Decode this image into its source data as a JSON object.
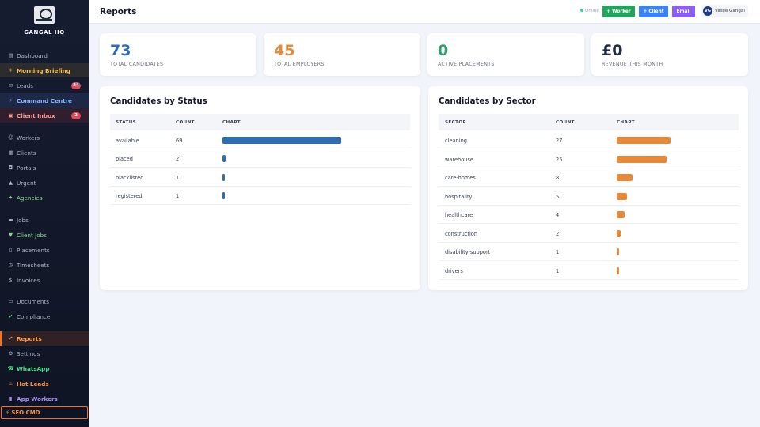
{
  "app": {
    "brand": "GANGAL HQ"
  },
  "header": {
    "title": "Reports",
    "status": "Online",
    "buttons": {
      "worker": "+ Worker",
      "client": "+ Client",
      "email": "Email"
    },
    "user": {
      "initials": "VG",
      "name": "Vasile Gangal"
    }
  },
  "sidebar": {
    "items": [
      {
        "label": "Dashboard",
        "icon": "chart-icon"
      },
      {
        "label": "Morning Briefing",
        "icon": "sunrise-icon"
      },
      {
        "label": "Leads",
        "icon": "envelope-icon",
        "badge": "24"
      },
      {
        "label": "Command Centre",
        "icon": "lightning-icon"
      },
      {
        "label": "Client Inbox",
        "icon": "inbox-icon",
        "badge": "2"
      },
      {
        "label": "Workers",
        "icon": "people-icon"
      },
      {
        "label": "Clients",
        "icon": "building-icon"
      },
      {
        "label": "Portals",
        "icon": "lock-icon"
      },
      {
        "label": "Urgent",
        "icon": "siren-icon"
      },
      {
        "label": "Agencies",
        "icon": "handshake-icon"
      },
      {
        "label": "Jobs",
        "icon": "briefcase-icon"
      },
      {
        "label": "Client Jobs",
        "icon": "inbox-tray-icon"
      },
      {
        "label": "Placements",
        "icon": "clipboard-icon"
      },
      {
        "label": "Timesheets",
        "icon": "clock-icon"
      },
      {
        "label": "Invoices",
        "icon": "money-icon"
      },
      {
        "label": "Documents",
        "icon": "document-icon"
      },
      {
        "label": "Compliance",
        "icon": "check-icon"
      },
      {
        "label": "Reports",
        "icon": "chart-up-icon"
      },
      {
        "label": "Settings",
        "icon": "gear-icon"
      },
      {
        "label": "WhatsApp",
        "icon": "phone-icon"
      },
      {
        "label": "Hot Leads",
        "icon": "fire-icon"
      },
      {
        "label": "App Workers",
        "icon": "mobile-icon"
      }
    ],
    "seo": "⚡ SEO CMD"
  },
  "stats": [
    {
      "value": "73",
      "label": "TOTAL CANDIDATES",
      "color": "#2f6db3"
    },
    {
      "value": "45",
      "label": "TOTAL EMPLOYERS",
      "color": "#e8893a"
    },
    {
      "value": "0",
      "label": "ACTIVE PLACEMENTS",
      "color": "#2f9e6b"
    },
    {
      "value": "£0",
      "label": "REVENUE THIS MONTH",
      "color": "#1e2a44"
    }
  ],
  "status_panel": {
    "title": "Candidates by Status",
    "columns": [
      "STATUS",
      "COUNT",
      "CHART"
    ],
    "bar_color": "#2f6db3",
    "rows": [
      {
        "label": "available",
        "count": 69
      },
      {
        "label": "placed",
        "count": 2
      },
      {
        "label": "blacklisted",
        "count": 1
      },
      {
        "label": "registered",
        "count": 1
      }
    ]
  },
  "sector_panel": {
    "title": "Candidates by Sector",
    "columns": [
      "SECTOR",
      "COUNT",
      "CHART"
    ],
    "bar_color": "#e8893a",
    "rows": [
      {
        "label": "cleaning",
        "count": 27
      },
      {
        "label": "warehouse",
        "count": 25
      },
      {
        "label": "care-homes",
        "count": 8
      },
      {
        "label": "hospitality",
        "count": 5
      },
      {
        "label": "healthcare",
        "count": 4
      },
      {
        "label": "construction",
        "count": 2
      },
      {
        "label": "disability-support",
        "count": 1
      },
      {
        "label": "drivers",
        "count": 1
      }
    ]
  }
}
